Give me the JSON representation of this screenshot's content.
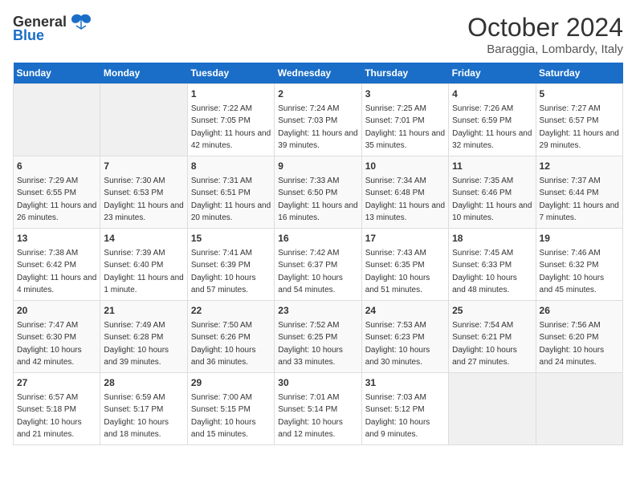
{
  "logo": {
    "general": "General",
    "blue": "Blue"
  },
  "header": {
    "month": "October 2024",
    "location": "Baraggia, Lombardy, Italy"
  },
  "weekdays": [
    "Sunday",
    "Monday",
    "Tuesday",
    "Wednesday",
    "Thursday",
    "Friday",
    "Saturday"
  ],
  "weeks": [
    [
      null,
      null,
      {
        "day": "1",
        "sunrise": "Sunrise: 7:22 AM",
        "sunset": "Sunset: 7:05 PM",
        "daylight": "Daylight: 11 hours and 42 minutes."
      },
      {
        "day": "2",
        "sunrise": "Sunrise: 7:24 AM",
        "sunset": "Sunset: 7:03 PM",
        "daylight": "Daylight: 11 hours and 39 minutes."
      },
      {
        "day": "3",
        "sunrise": "Sunrise: 7:25 AM",
        "sunset": "Sunset: 7:01 PM",
        "daylight": "Daylight: 11 hours and 35 minutes."
      },
      {
        "day": "4",
        "sunrise": "Sunrise: 7:26 AM",
        "sunset": "Sunset: 6:59 PM",
        "daylight": "Daylight: 11 hours and 32 minutes."
      },
      {
        "day": "5",
        "sunrise": "Sunrise: 7:27 AM",
        "sunset": "Sunset: 6:57 PM",
        "daylight": "Daylight: 11 hours and 29 minutes."
      }
    ],
    [
      {
        "day": "6",
        "sunrise": "Sunrise: 7:29 AM",
        "sunset": "Sunset: 6:55 PM",
        "daylight": "Daylight: 11 hours and 26 minutes."
      },
      {
        "day": "7",
        "sunrise": "Sunrise: 7:30 AM",
        "sunset": "Sunset: 6:53 PM",
        "daylight": "Daylight: 11 hours and 23 minutes."
      },
      {
        "day": "8",
        "sunrise": "Sunrise: 7:31 AM",
        "sunset": "Sunset: 6:51 PM",
        "daylight": "Daylight: 11 hours and 20 minutes."
      },
      {
        "day": "9",
        "sunrise": "Sunrise: 7:33 AM",
        "sunset": "Sunset: 6:50 PM",
        "daylight": "Daylight: 11 hours and 16 minutes."
      },
      {
        "day": "10",
        "sunrise": "Sunrise: 7:34 AM",
        "sunset": "Sunset: 6:48 PM",
        "daylight": "Daylight: 11 hours and 13 minutes."
      },
      {
        "day": "11",
        "sunrise": "Sunrise: 7:35 AM",
        "sunset": "Sunset: 6:46 PM",
        "daylight": "Daylight: 11 hours and 10 minutes."
      },
      {
        "day": "12",
        "sunrise": "Sunrise: 7:37 AM",
        "sunset": "Sunset: 6:44 PM",
        "daylight": "Daylight: 11 hours and 7 minutes."
      }
    ],
    [
      {
        "day": "13",
        "sunrise": "Sunrise: 7:38 AM",
        "sunset": "Sunset: 6:42 PM",
        "daylight": "Daylight: 11 hours and 4 minutes."
      },
      {
        "day": "14",
        "sunrise": "Sunrise: 7:39 AM",
        "sunset": "Sunset: 6:40 PM",
        "daylight": "Daylight: 11 hours and 1 minute."
      },
      {
        "day": "15",
        "sunrise": "Sunrise: 7:41 AM",
        "sunset": "Sunset: 6:39 PM",
        "daylight": "Daylight: 10 hours and 57 minutes."
      },
      {
        "day": "16",
        "sunrise": "Sunrise: 7:42 AM",
        "sunset": "Sunset: 6:37 PM",
        "daylight": "Daylight: 10 hours and 54 minutes."
      },
      {
        "day": "17",
        "sunrise": "Sunrise: 7:43 AM",
        "sunset": "Sunset: 6:35 PM",
        "daylight": "Daylight: 10 hours and 51 minutes."
      },
      {
        "day": "18",
        "sunrise": "Sunrise: 7:45 AM",
        "sunset": "Sunset: 6:33 PM",
        "daylight": "Daylight: 10 hours and 48 minutes."
      },
      {
        "day": "19",
        "sunrise": "Sunrise: 7:46 AM",
        "sunset": "Sunset: 6:32 PM",
        "daylight": "Daylight: 10 hours and 45 minutes."
      }
    ],
    [
      {
        "day": "20",
        "sunrise": "Sunrise: 7:47 AM",
        "sunset": "Sunset: 6:30 PM",
        "daylight": "Daylight: 10 hours and 42 minutes."
      },
      {
        "day": "21",
        "sunrise": "Sunrise: 7:49 AM",
        "sunset": "Sunset: 6:28 PM",
        "daylight": "Daylight: 10 hours and 39 minutes."
      },
      {
        "day": "22",
        "sunrise": "Sunrise: 7:50 AM",
        "sunset": "Sunset: 6:26 PM",
        "daylight": "Daylight: 10 hours and 36 minutes."
      },
      {
        "day": "23",
        "sunrise": "Sunrise: 7:52 AM",
        "sunset": "Sunset: 6:25 PM",
        "daylight": "Daylight: 10 hours and 33 minutes."
      },
      {
        "day": "24",
        "sunrise": "Sunrise: 7:53 AM",
        "sunset": "Sunset: 6:23 PM",
        "daylight": "Daylight: 10 hours and 30 minutes."
      },
      {
        "day": "25",
        "sunrise": "Sunrise: 7:54 AM",
        "sunset": "Sunset: 6:21 PM",
        "daylight": "Daylight: 10 hours and 27 minutes."
      },
      {
        "day": "26",
        "sunrise": "Sunrise: 7:56 AM",
        "sunset": "Sunset: 6:20 PM",
        "daylight": "Daylight: 10 hours and 24 minutes."
      }
    ],
    [
      {
        "day": "27",
        "sunrise": "Sunrise: 6:57 AM",
        "sunset": "Sunset: 5:18 PM",
        "daylight": "Daylight: 10 hours and 21 minutes."
      },
      {
        "day": "28",
        "sunrise": "Sunrise: 6:59 AM",
        "sunset": "Sunset: 5:17 PM",
        "daylight": "Daylight: 10 hours and 18 minutes."
      },
      {
        "day": "29",
        "sunrise": "Sunrise: 7:00 AM",
        "sunset": "Sunset: 5:15 PM",
        "daylight": "Daylight: 10 hours and 15 minutes."
      },
      {
        "day": "30",
        "sunrise": "Sunrise: 7:01 AM",
        "sunset": "Sunset: 5:14 PM",
        "daylight": "Daylight: 10 hours and 12 minutes."
      },
      {
        "day": "31",
        "sunrise": "Sunrise: 7:03 AM",
        "sunset": "Sunset: 5:12 PM",
        "daylight": "Daylight: 10 hours and 9 minutes."
      },
      null,
      null
    ]
  ]
}
